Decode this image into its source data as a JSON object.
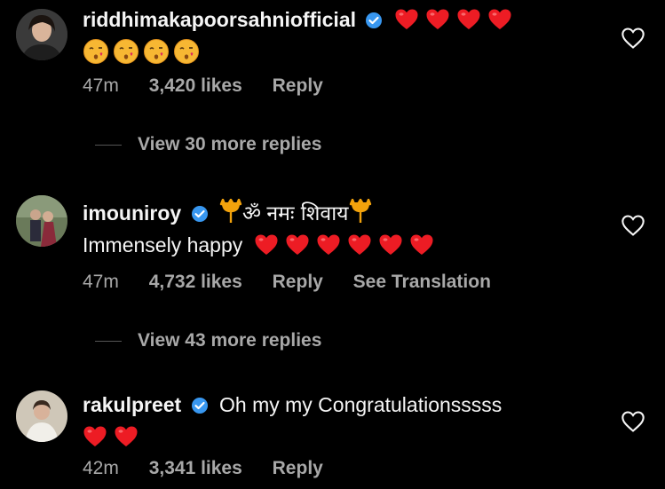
{
  "comments": [
    {
      "username": "riddhimakapoorsahniofficial",
      "hearts_count": 4,
      "kiss_count": 4,
      "time": "47m",
      "likes": "3,420 likes",
      "reply": "Reply"
    },
    {
      "username": "imouniroy",
      "caption_symbol": "ॐ",
      "caption_text": "नमः शिवाय",
      "text": "Immensely happy",
      "hearts_count": 6,
      "time": "47m",
      "likes": "4,732 likes",
      "reply": "Reply",
      "translate": "See Translation"
    },
    {
      "username": "rakulpreet",
      "text": "Oh my my Congratulationsssss",
      "hearts_count": 2,
      "time": "42m",
      "likes": "3,341 likes",
      "reply": "Reply"
    }
  ],
  "view_more": [
    "View 30 more replies",
    "View 43 more replies"
  ],
  "colors": {
    "background": "#000000",
    "text": "#f5f5f5",
    "muted": "#a8a8a8",
    "verified": "#3897f0",
    "heart": "#ed1c24"
  },
  "icons": {
    "verified": "verified-badge-icon",
    "like": "heart-outline-icon",
    "trident": "trident-icon"
  }
}
